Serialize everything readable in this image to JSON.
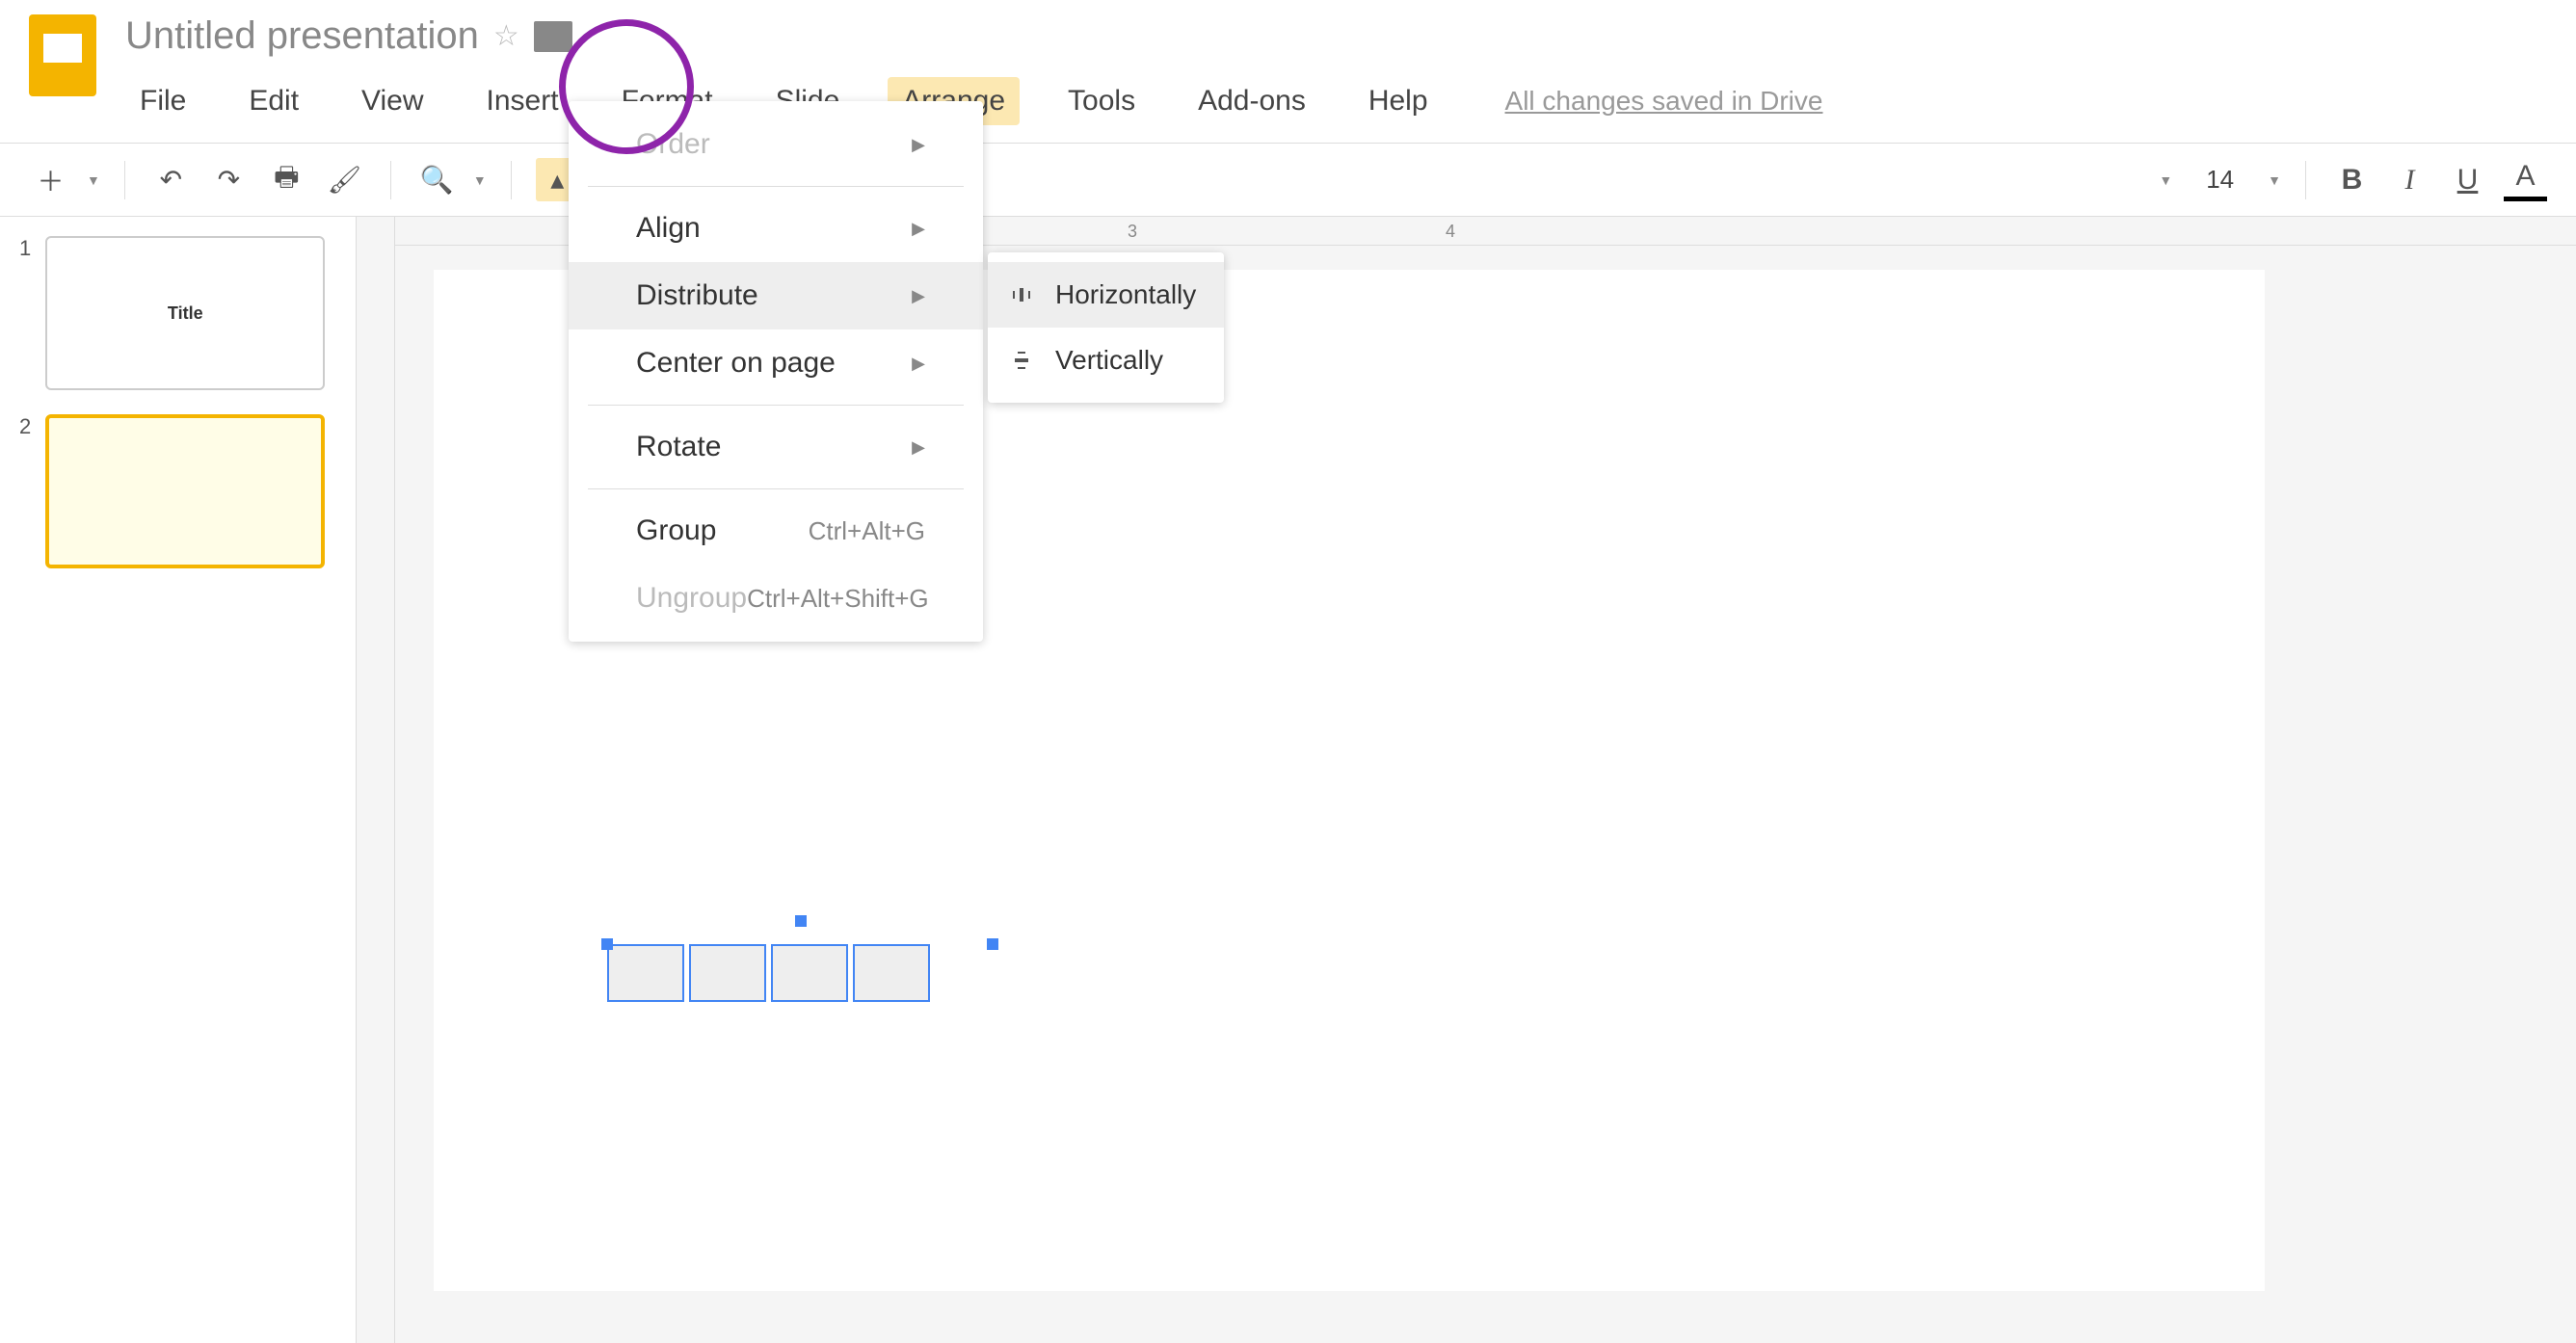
{
  "doc": {
    "title": "Untitled presentation"
  },
  "saved_status": "All changes saved in Drive",
  "menubar": {
    "items": [
      "File",
      "Edit",
      "View",
      "Insert",
      "Format",
      "Slide",
      "Arrange",
      "Tools",
      "Add-ons",
      "Help"
    ],
    "active_index": 6
  },
  "toolbar": {
    "font_size": "14"
  },
  "ruler": {
    "marks": [
      "3",
      "4"
    ]
  },
  "slides": [
    {
      "num": "1",
      "label": "Title",
      "selected": false
    },
    {
      "num": "2",
      "label": "",
      "selected": true
    }
  ],
  "arrange_menu": {
    "items": [
      {
        "label": "Order",
        "has_submenu": true,
        "disabled": true
      },
      {
        "sep": true
      },
      {
        "label": "Align",
        "has_submenu": true
      },
      {
        "label": "Distribute",
        "has_submenu": true,
        "highlighted": true
      },
      {
        "label": "Center on page",
        "has_submenu": true
      },
      {
        "sep": true
      },
      {
        "label": "Rotate",
        "has_submenu": true
      },
      {
        "sep": true
      },
      {
        "label": "Group",
        "shortcut": "Ctrl+Alt+G"
      },
      {
        "label": "Ungroup",
        "shortcut": "Ctrl+Alt+Shift+G",
        "disabled": true
      }
    ]
  },
  "distribute_submenu": {
    "items": [
      {
        "label": "Horizontally",
        "highlighted": true
      },
      {
        "label": "Vertically"
      }
    ]
  }
}
